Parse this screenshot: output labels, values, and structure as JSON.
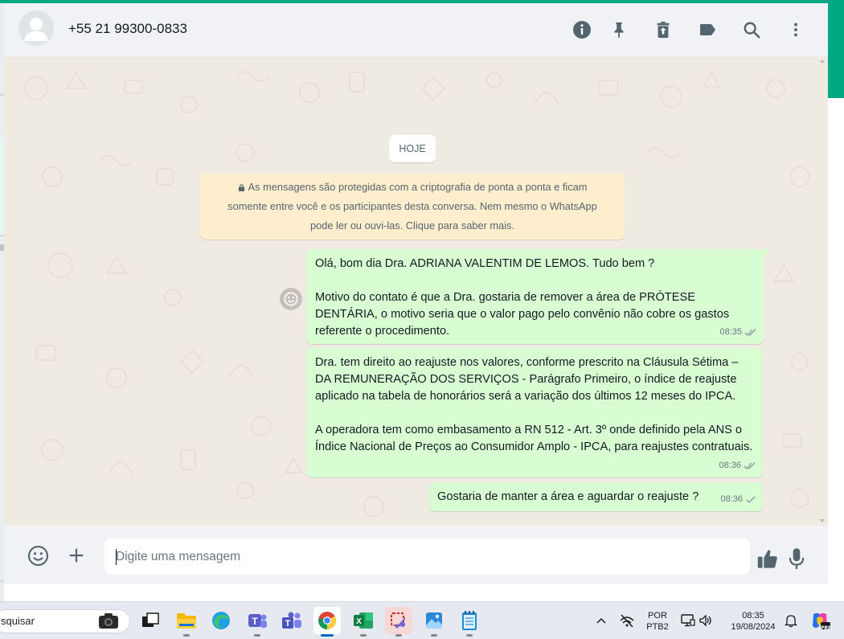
{
  "header": {
    "contact_name": "+55 21 99300-0833",
    "icons": [
      "info-icon",
      "pin-icon",
      "delete-icon",
      "label-icon",
      "search-icon",
      "menu-icon"
    ]
  },
  "chat": {
    "date_chip": "HOJE",
    "encryption_notice": {
      "line1": "As mensagens são protegidas com a criptografia de ponta a ponta e ficam",
      "line2": "somente entre você e os participantes desta conversa. Nem mesmo o WhatsApp",
      "line3": "pode ler ou ouvi-las. Clique para saber mais."
    },
    "messages": [
      {
        "text": "Olá, bom dia Dra. ADRIANA VALENTIM DE LEMOS. Tudo bem ?\n\nMotivo do contato é que a Dra. gostaria de remover a área de PRÓTESE DENTÁRIA, o motivo seria que o valor pago pelo convênio não cobre os gastos referente o procedimento.",
        "time": "08:35",
        "status": "read"
      },
      {
        "text": "Dra. tem direito ao reajuste nos valores, conforme prescrito na Cláusula Sétima – DA REMUNERAÇÃO DOS SERVIÇOS - Parágrafo Primeiro, o índice de reajuste aplicado na tabela de honorários será a variação dos últimos 12 meses do IPCA.\n\nA operadora tem como embasamento a RN 512 - Art. 3º onde definido pela ANS o Índice Nacional de Preços ao Consumidor Amplo - IPCA, para reajustes contratuais.",
        "time": "08:36",
        "status": "read"
      },
      {
        "text": "Gostaria de manter a área e aguardar o reajuste ?",
        "time": "08:36",
        "status": "sent"
      }
    ]
  },
  "composer": {
    "placeholder": "Digite uma mensagem"
  },
  "taskbar": {
    "search_text": "squisar",
    "language_top": "POR",
    "language_bottom": "PTB2",
    "time": "08:35",
    "date": "19/08/2024",
    "copilot_badge": "PRE"
  },
  "colors": {
    "accent": "#00a884",
    "outgoing_bubble": "#d9fdd3",
    "chat_background": "#efeae2",
    "notice_background": "#ffeecd",
    "read_ticks": "#53bdeb"
  }
}
